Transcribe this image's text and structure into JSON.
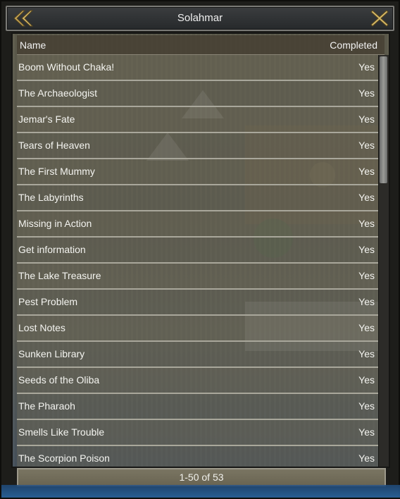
{
  "window": {
    "title": "Solahmar",
    "back_icon": "double-chevron-left-icon",
    "close_icon": "close-x-icon"
  },
  "table": {
    "headers": {
      "name": "Name",
      "completed": "Completed"
    },
    "rows": [
      {
        "name": "Boom Without Chaka!",
        "completed": "Yes"
      },
      {
        "name": "The Archaeologist",
        "completed": "Yes"
      },
      {
        "name": "Jemar's Fate",
        "completed": "Yes"
      },
      {
        "name": "Tears of Heaven",
        "completed": "Yes"
      },
      {
        "name": "The First Mummy",
        "completed": "Yes"
      },
      {
        "name": "The Labyrinths",
        "completed": "Yes"
      },
      {
        "name": "Missing in Action",
        "completed": "Yes"
      },
      {
        "name": "Get information",
        "completed": "Yes"
      },
      {
        "name": "The Lake Treasure",
        "completed": "Yes"
      },
      {
        "name": "Pest Problem",
        "completed": "Yes"
      },
      {
        "name": "Lost Notes",
        "completed": "Yes"
      },
      {
        "name": "Sunken Library",
        "completed": "Yes"
      },
      {
        "name": "Seeds of the Oliba",
        "completed": "Yes"
      },
      {
        "name": "The Pharaoh",
        "completed": "Yes"
      },
      {
        "name": "Smells Like Trouble",
        "completed": "Yes"
      },
      {
        "name": "The Scorpion Poison",
        "completed": "Yes"
      }
    ]
  },
  "pagination": {
    "label": "1-50 of 53"
  },
  "colors": {
    "arrow": "#d8b860",
    "title_text": "#f0f0f0"
  }
}
